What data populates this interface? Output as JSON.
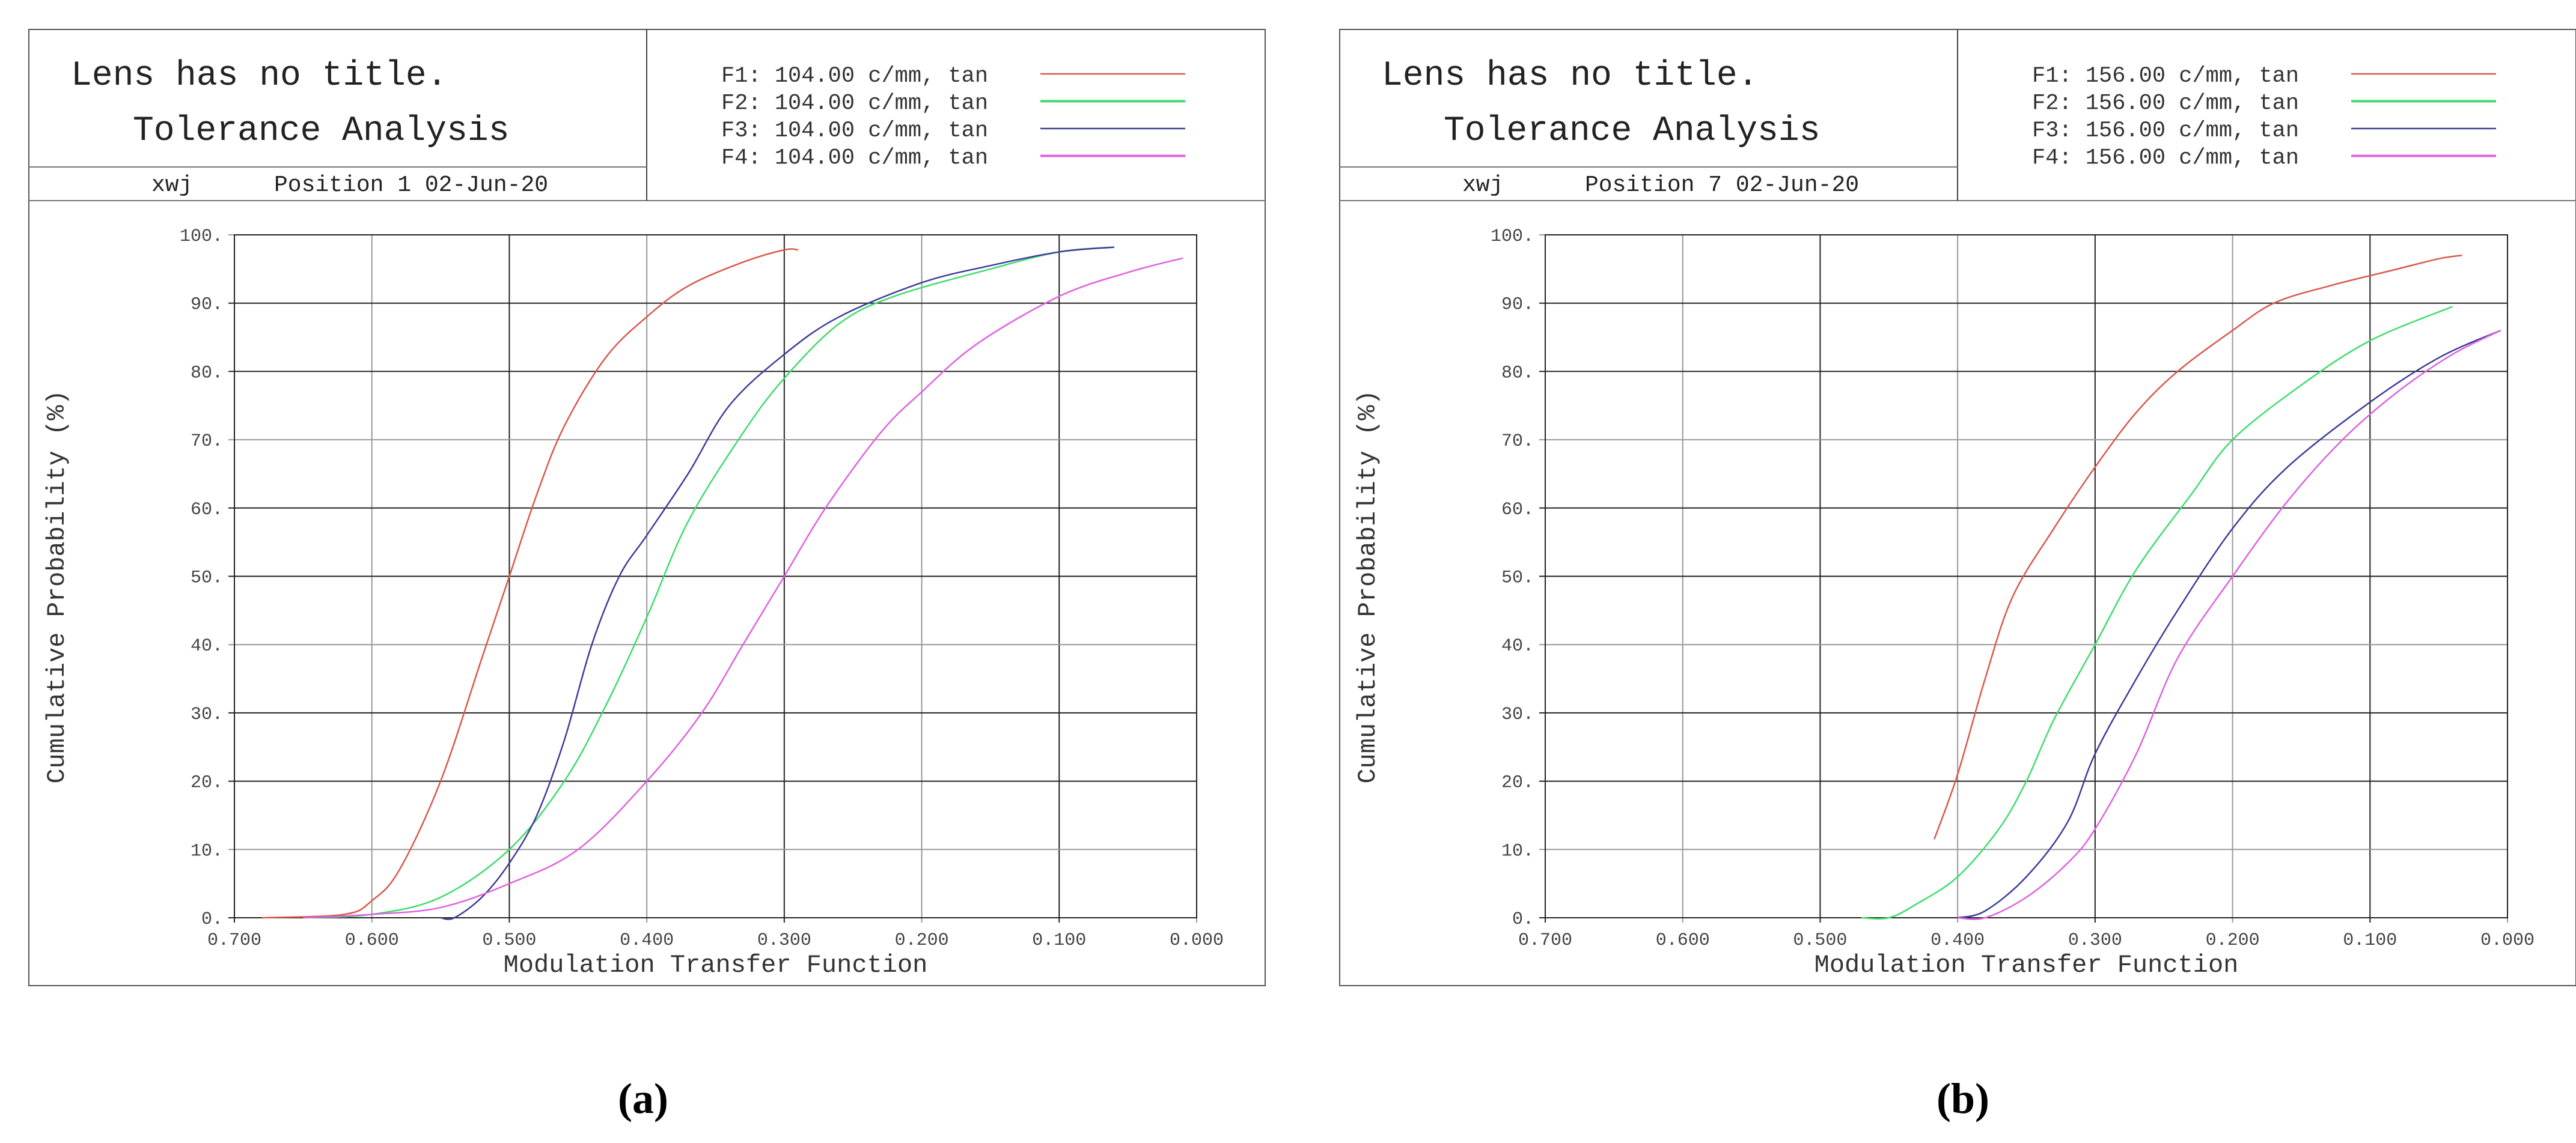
{
  "chart_data": [
    {
      "type": "line",
      "caption": "(a)",
      "header": {
        "title": "Lens has no title.",
        "subtitle": "Tolerance Analysis",
        "user": "xwj",
        "position_date": "Position 1  02-Jun-20"
      },
      "xlabel": "Modulation Transfer Function",
      "ylabel": "Cumulative Probability (%)",
      "xlim": [
        0.7,
        0.0
      ],
      "ylim": [
        0,
        100
      ],
      "x_ticks": [
        "0.700",
        "0.600",
        "0.500",
        "0.400",
        "0.300",
        "0.200",
        "0.100",
        "0.000"
      ],
      "y_ticks": [
        "0.",
        "10.",
        "20.",
        "30.",
        "40.",
        "50.",
        "60.",
        "70.",
        "80.",
        "90.",
        "100."
      ],
      "grid": true,
      "series": [
        {
          "name": "F1: 104.00 c/mm, tan",
          "color": "#d9574a",
          "points": [
            [
              0.68,
              0
            ],
            [
              0.62,
              0.5
            ],
            [
              0.6,
              2.5
            ],
            [
              0.58,
              7
            ],
            [
              0.55,
              20
            ],
            [
              0.52,
              38
            ],
            [
              0.5,
              50
            ],
            [
              0.48,
              62
            ],
            [
              0.46,
              72
            ],
            [
              0.43,
              82
            ],
            [
              0.4,
              88
            ],
            [
              0.37,
              92.5
            ],
            [
              0.33,
              96
            ],
            [
              0.3,
              97.8
            ],
            [
              0.29,
              97.8
            ]
          ]
        },
        {
          "name": "F2: 104.00 c/mm, tan",
          "color": "#3ddc6a",
          "points": [
            [
              0.65,
              0
            ],
            [
              0.6,
              0.5
            ],
            [
              0.55,
              3
            ],
            [
              0.5,
              10
            ],
            [
              0.46,
              20
            ],
            [
              0.43,
              31
            ],
            [
              0.4,
              44
            ],
            [
              0.37,
              58
            ],
            [
              0.33,
              71
            ],
            [
              0.3,
              79
            ],
            [
              0.26,
              87
            ],
            [
              0.22,
              91
            ],
            [
              0.15,
              95
            ],
            [
              0.1,
              97.5
            ],
            [
              0.06,
              98.2
            ]
          ]
        },
        {
          "name": "F3: 104.00 c/mm, tan",
          "color": "#3b3b9a",
          "points": [
            [
              0.55,
              0
            ],
            [
              0.54,
              0
            ],
            [
              0.52,
              3
            ],
            [
              0.5,
              8
            ],
            [
              0.48,
              15
            ],
            [
              0.46,
              26
            ],
            [
              0.44,
              40
            ],
            [
              0.42,
              50
            ],
            [
              0.4,
              56
            ],
            [
              0.37,
              65
            ],
            [
              0.34,
              75
            ],
            [
              0.3,
              82.5
            ],
            [
              0.26,
              88
            ],
            [
              0.2,
              93
            ],
            [
              0.15,
              95.5
            ],
            [
              0.1,
              97.5
            ],
            [
              0.06,
              98.2
            ]
          ]
        },
        {
          "name": "F4: 104.00 c/mm, tan",
          "color": "#e060e0",
          "points": [
            [
              0.65,
              0
            ],
            [
              0.6,
              0.5
            ],
            [
              0.55,
              1.5
            ],
            [
              0.5,
              5
            ],
            [
              0.45,
              10
            ],
            [
              0.4,
              20
            ],
            [
              0.36,
              30
            ],
            [
              0.33,
              40
            ],
            [
              0.3,
              50
            ],
            [
              0.27,
              60
            ],
            [
              0.23,
              71
            ],
            [
              0.2,
              77
            ],
            [
              0.16,
              84
            ],
            [
              0.1,
              91
            ],
            [
              0.05,
              94.5
            ],
            [
              0.01,
              96.6
            ]
          ]
        }
      ]
    },
    {
      "type": "line",
      "caption": "(b)",
      "header": {
        "title": "Lens has no title.",
        "subtitle": "Tolerance Analysis",
        "user": "xwj",
        "position_date": "Position 7  02-Jun-20"
      },
      "xlabel": "Modulation Transfer Function",
      "ylabel": "Cumulative Probability (%)",
      "xlim": [
        0.7,
        0.0
      ],
      "ylim": [
        0,
        100
      ],
      "x_ticks": [
        "0.700",
        "0.600",
        "0.500",
        "0.400",
        "0.300",
        "0.200",
        "0.100",
        "0.000"
      ],
      "y_ticks": [
        "0.",
        "10.",
        "20.",
        "30.",
        "40.",
        "50.",
        "60.",
        "70.",
        "80.",
        "90.",
        "100."
      ],
      "grid": true,
      "series": [
        {
          "name": "F1: 156.00 c/mm, tan",
          "color": "#d9574a",
          "points": [
            [
              0.417,
              11.5
            ],
            [
              0.4,
              21
            ],
            [
              0.38,
              35
            ],
            [
              0.36,
              47
            ],
            [
              0.33,
              57
            ],
            [
              0.3,
              66
            ],
            [
              0.27,
              74
            ],
            [
              0.24,
              80
            ],
            [
              0.2,
              86
            ],
            [
              0.17,
              90
            ],
            [
              0.13,
              92.5
            ],
            [
              0.08,
              95
            ],
            [
              0.05,
              96.5
            ],
            [
              0.033,
              97
            ]
          ]
        },
        {
          "name": "F2: 156.00 c/mm, tan",
          "color": "#3ddc6a",
          "points": [
            [
              0.47,
              0
            ],
            [
              0.45,
              0
            ],
            [
              0.43,
              2
            ],
            [
              0.4,
              6
            ],
            [
              0.37,
              13
            ],
            [
              0.35,
              20
            ],
            [
              0.33,
              29
            ],
            [
              0.3,
              40
            ],
            [
              0.27,
              51
            ],
            [
              0.23,
              62
            ],
            [
              0.2,
              70
            ],
            [
              0.15,
              78
            ],
            [
              0.1,
              84.5
            ],
            [
              0.04,
              89.5
            ]
          ]
        },
        {
          "name": "F3: 156.00 c/mm, tan",
          "color": "#3b3b9a",
          "points": [
            [
              0.4,
              0
            ],
            [
              0.38,
              1
            ],
            [
              0.35,
              6
            ],
            [
              0.32,
              14
            ],
            [
              0.3,
              24
            ],
            [
              0.27,
              35
            ],
            [
              0.24,
              45
            ],
            [
              0.2,
              57
            ],
            [
              0.16,
              66
            ],
            [
              0.1,
              75.5
            ],
            [
              0.05,
              82
            ],
            [
              0.005,
              86
            ]
          ]
        },
        {
          "name": "F4: 156.00 c/mm, tan",
          "color": "#e060e0",
          "points": [
            [
              0.4,
              0
            ],
            [
              0.38,
              0
            ],
            [
              0.35,
              3
            ],
            [
              0.32,
              8
            ],
            [
              0.3,
              13
            ],
            [
              0.27,
              24
            ],
            [
              0.24,
              38
            ],
            [
              0.2,
              50
            ],
            [
              0.16,
              61
            ],
            [
              0.12,
              70
            ],
            [
              0.08,
              77
            ],
            [
              0.04,
              82.5
            ],
            [
              0.005,
              86
            ]
          ]
        }
      ]
    }
  ]
}
